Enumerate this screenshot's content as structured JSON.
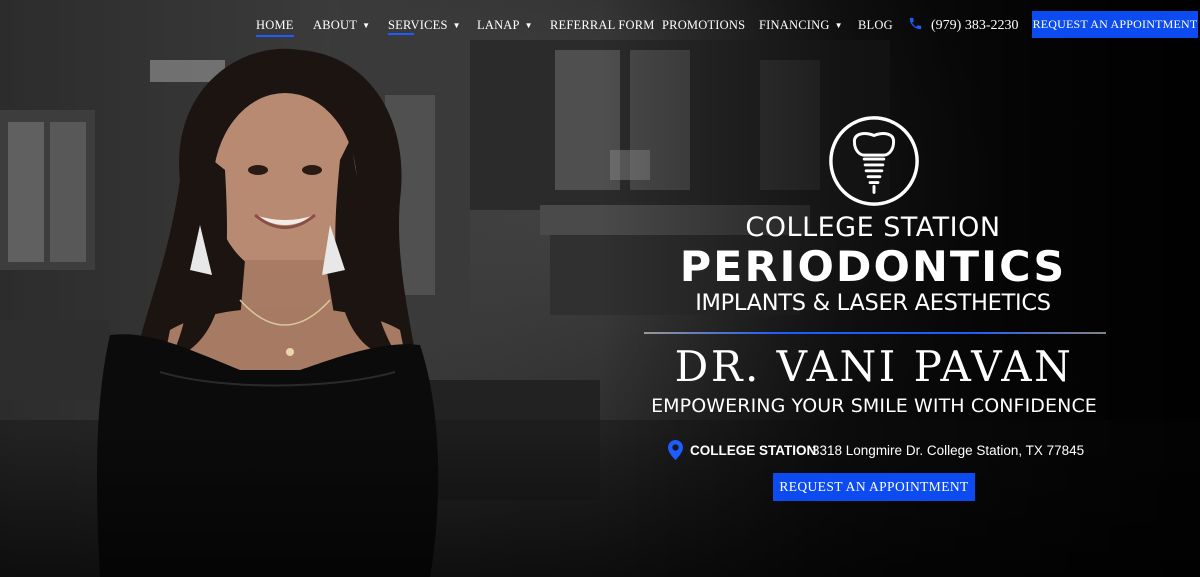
{
  "nav": {
    "items": [
      {
        "label": "HOME",
        "chevron": false
      },
      {
        "label": "ABOUT",
        "chevron": true
      },
      {
        "label": "SERVICES",
        "chevron": true
      },
      {
        "label": "LANAP",
        "chevron": true
      },
      {
        "label": "REFERRAL FORM",
        "chevron": false
      },
      {
        "label": "PROMOTIONS",
        "chevron": false
      },
      {
        "label": "FINANCING",
        "chevron": true
      },
      {
        "label": "BLOG",
        "chevron": false
      }
    ],
    "phone": "(979) 383-2230",
    "cta": "REQUEST AN APPOINTMENT"
  },
  "brand": {
    "line1": "COLLEGE STATION",
    "line2": "PERIODONTICS",
    "line3": "IMPLANTS & LASER AESTHETICS"
  },
  "hero": {
    "doctor": "DR. VANI PAVAN",
    "tagline": "EMPOWERING YOUR SMILE WITH CONFIDENCE",
    "location_city": "COLLEGE STATION",
    "location_address": "3318 Longmire Dr. College Station, TX 77845",
    "cta": "REQUEST AN APPOINTMENT"
  },
  "colors": {
    "accent": "#0c4bf0",
    "background": "#0d0d0d",
    "text": "#ffffff"
  },
  "icons": {
    "phone": "phone-icon",
    "location": "location-pin-icon",
    "logo": "dental-implant-logo-icon",
    "chevron": "chevron-down-icon"
  }
}
